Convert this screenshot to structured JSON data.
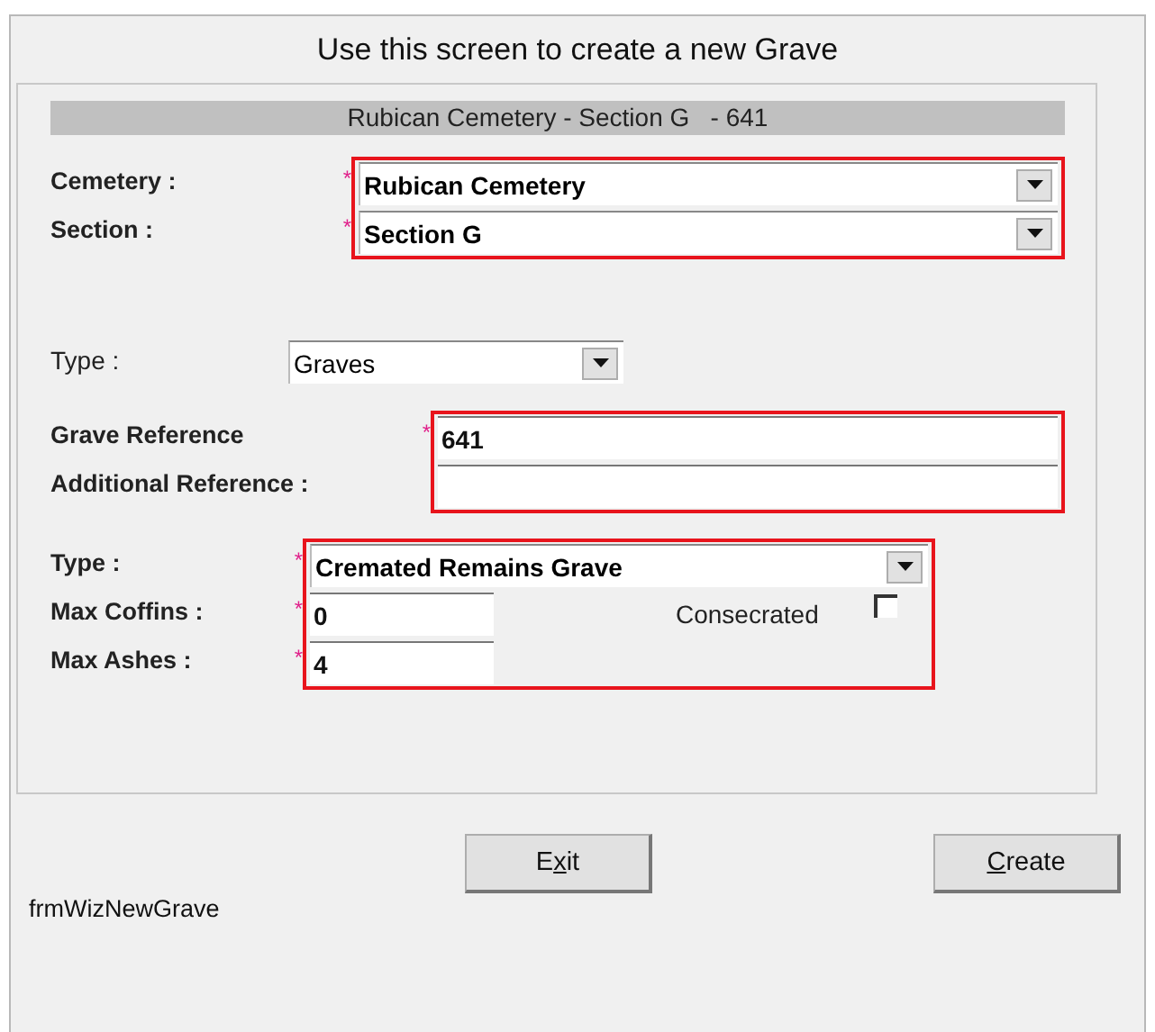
{
  "window": {
    "title": "Use this screen to create a new Grave"
  },
  "header": "Rubican Cemetery - Section G   - 641",
  "sections": [
    {
      "highlighted": true,
      "fields": [
        {
          "kind": "combo",
          "label": "Cemetery :",
          "marker": "*",
          "value": "Rubican Cemetery"
        },
        {
          "kind": "combo",
          "label": "Section :",
          "marker": "*",
          "value": "Section G"
        }
      ]
    },
    {
      "highlighted": false,
      "fields": [
        {
          "kind": "combo",
          "label": "Type :",
          "value": "Graves"
        }
      ]
    },
    {
      "highlighted": true,
      "fields": [
        {
          "kind": "text",
          "label": "Grave Reference",
          "marker": "*",
          "value": "641"
        },
        {
          "kind": "text",
          "label": "Additional Reference :"
        }
      ]
    },
    {
      "highlighted": true,
      "fields": [
        {
          "kind": "combo",
          "label": "Type :",
          "marker": "*",
          "value": "Cremated Remains Grave"
        },
        {
          "kind": "text",
          "label": "Max Coffins :",
          "marker": "*",
          "value": "0",
          "checkbox": {
            "label": "Consecrated",
            "checked": false
          }
        },
        {
          "kind": "text",
          "label": "Max Ashes :",
          "marker": "*",
          "value": "4"
        }
      ]
    }
  ],
  "buttons": [
    {
      "before": "E",
      "key": "x",
      "after": "it"
    },
    {
      "key": "C",
      "after": "reate"
    }
  ],
  "form_name": "frmWizNewGrave"
}
